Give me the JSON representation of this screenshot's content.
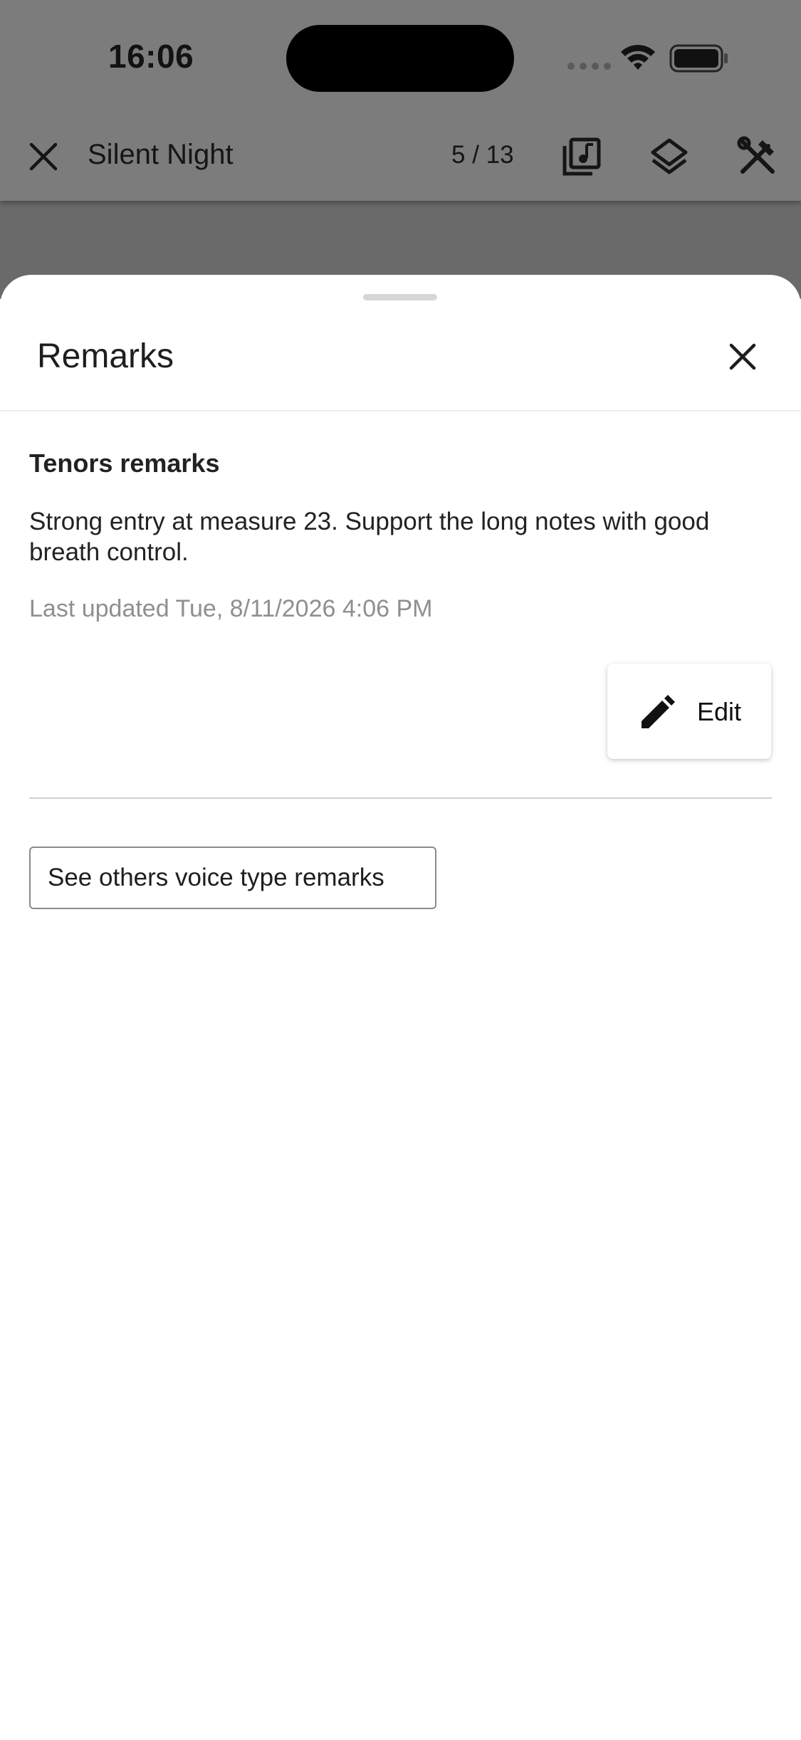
{
  "status_bar": {
    "time": "16:06"
  },
  "app_bar": {
    "title": "Silent Night",
    "page_counter": "5 / 13",
    "icons": [
      "close-icon",
      "music-library-icon",
      "layers-icon",
      "tools-icon"
    ]
  },
  "sheet": {
    "title": "Remarks",
    "voice_heading": "Tenors remarks",
    "remark": "Strong entry at measure 23. Support the long notes with good breath control.",
    "last_updated": "Last updated Tue, 8/11/2026 4:06 PM",
    "edit_label": "Edit",
    "others_button_label": "See others voice type remarks"
  }
}
